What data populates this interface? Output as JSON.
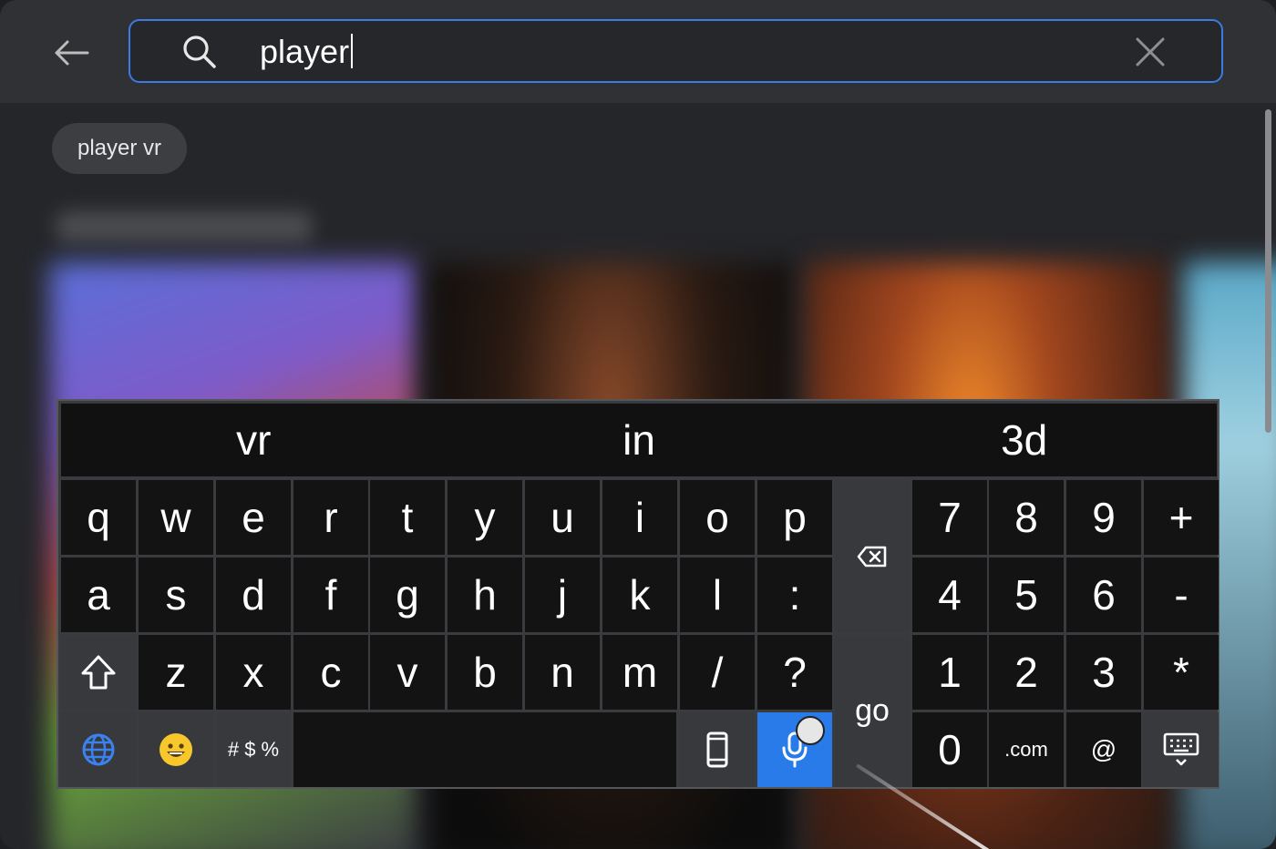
{
  "search": {
    "query": "player",
    "accent_color": "#3b7be6"
  },
  "suggestion_chip": "player vr",
  "keyboard": {
    "suggestions": [
      "vr",
      "in",
      "3d"
    ],
    "row1": [
      "q",
      "w",
      "e",
      "r",
      "t",
      "y",
      "u",
      "i",
      "o",
      "p"
    ],
    "row2": [
      "a",
      "s",
      "d",
      "f",
      "g",
      "h",
      "j",
      "k",
      "l",
      ":"
    ],
    "row3": [
      "z",
      "x",
      "c",
      "v",
      "b",
      "n",
      "m",
      "/",
      "?"
    ],
    "symbols_label": "# $ %",
    "go_label": "go",
    "numpad": [
      "7",
      "8",
      "9",
      "+",
      "4",
      "5",
      "6",
      "-",
      "1",
      "2",
      "3",
      "*",
      "0",
      ".com",
      "@"
    ],
    "mic_color": "#2a7bea"
  },
  "icons": [
    "back-arrow-icon",
    "search-icon",
    "clear-icon",
    "backspace-icon",
    "shift-icon",
    "globe-icon",
    "emoji-icon",
    "phone-icon",
    "microphone-icon",
    "keyboard-hide-icon"
  ]
}
